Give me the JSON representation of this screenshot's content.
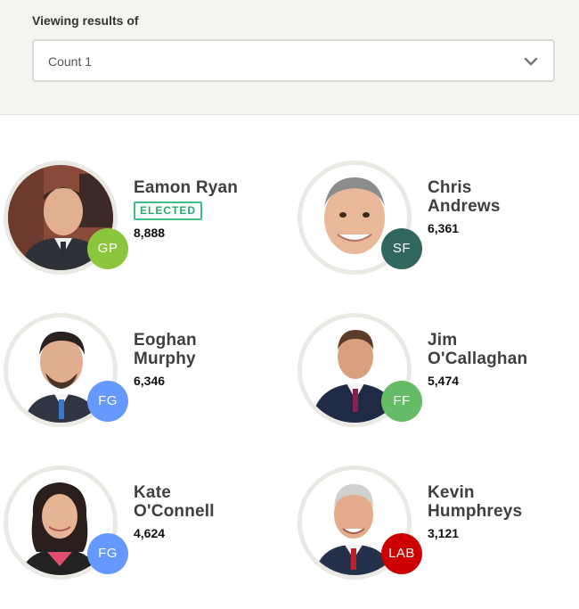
{
  "filter": {
    "label": "Viewing results of",
    "selected": "Count 1"
  },
  "candidates": [
    {
      "first": "Eamon Ryan",
      "second": "",
      "badge": "ELECTED",
      "votes": "8,888",
      "party": "GP",
      "party_color": "#8cc63f"
    },
    {
      "first": "Chris",
      "second": "Andrews",
      "badge": "",
      "votes": "6,361",
      "party": "SF",
      "party_color": "#326760"
    },
    {
      "first": "Eoghan",
      "second": "Murphy",
      "badge": "",
      "votes": "6,346",
      "party": "FG",
      "party_color": "#6699ff"
    },
    {
      "first": "Jim",
      "second": "O'Callaghan",
      "badge": "",
      "votes": "5,474",
      "party": "FF",
      "party_color": "#66bb66"
    },
    {
      "first": "Kate",
      "second": "O'Connell",
      "badge": "",
      "votes": "4,624",
      "party": "FG",
      "party_color": "#6699ff"
    },
    {
      "first": "Kevin",
      "second": "Humphreys",
      "badge": "",
      "votes": "3,121",
      "party": "LAB",
      "party_color": "#cc0000"
    }
  ]
}
